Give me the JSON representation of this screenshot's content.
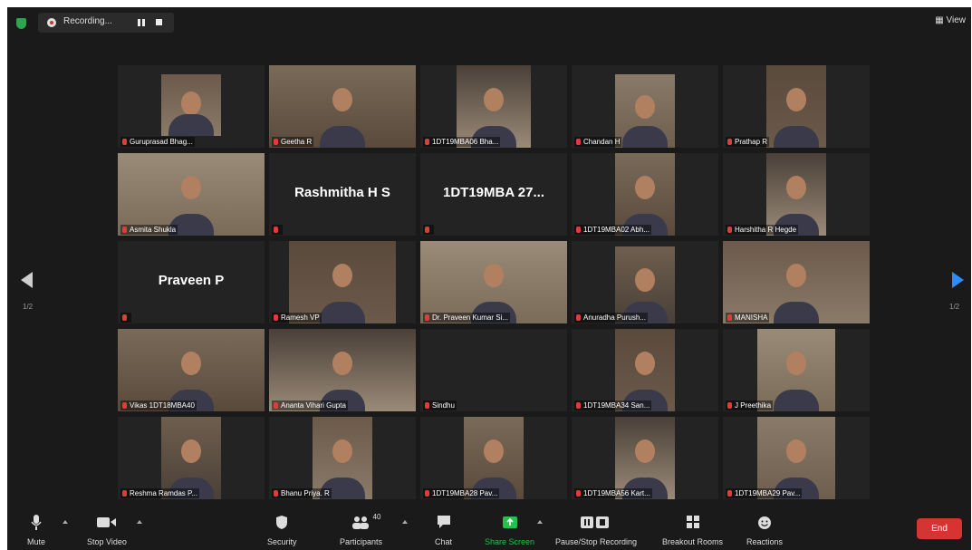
{
  "topbar": {
    "recording": "Recording...",
    "view": "View"
  },
  "nav": {
    "page_left": "1/2",
    "page_right": "1/2"
  },
  "tiles": [
    {
      "name": "Guruprasad Bhag...",
      "type": "video"
    },
    {
      "name": "Geetha R",
      "type": "video",
      "active": true
    },
    {
      "name": "1DT19MBA06 Bha...",
      "type": "video"
    },
    {
      "name": "Chandan H",
      "type": "video"
    },
    {
      "name": "Prathap R",
      "type": "video"
    },
    {
      "name": "Asmita Shukla",
      "type": "video"
    },
    {
      "name": "",
      "big": "Rashmitha H S",
      "type": "name"
    },
    {
      "name": "",
      "big": "1DT19MBA 27...",
      "type": "name"
    },
    {
      "name": "1DT19MBA02 Abh...",
      "type": "video"
    },
    {
      "name": "Harshitha R Hegde",
      "type": "video"
    },
    {
      "name": "",
      "big": "Praveen P",
      "type": "name"
    },
    {
      "name": "Ramesh VP",
      "type": "video"
    },
    {
      "name": "Dr. Praveen Kumar Si...",
      "type": "video"
    },
    {
      "name": "Anuradha Purush...",
      "type": "video"
    },
    {
      "name": "MANISHA",
      "type": "video"
    },
    {
      "name": "Vikas 1DT18MBA40",
      "type": "video"
    },
    {
      "name": "Ananta Vihari Gupta",
      "type": "video"
    },
    {
      "name": "Sindhu",
      "type": "empty"
    },
    {
      "name": "1DT19MBA34 San...",
      "type": "video"
    },
    {
      "name": "J Preethika",
      "type": "video"
    },
    {
      "name": "Reshma Ramdas P...",
      "type": "video"
    },
    {
      "name": "Bhanu Priya. R",
      "type": "video"
    },
    {
      "name": "1DT19MBA28 Pav...",
      "type": "video"
    },
    {
      "name": "1DT19MBA56 Kart...",
      "type": "video"
    },
    {
      "name": "1DT19MBA29 Pav...",
      "type": "video"
    }
  ],
  "toolbar": {
    "mute": "Mute",
    "stop_video": "Stop Video",
    "security": "Security",
    "participants": "Participants",
    "participants_count": "40",
    "chat": "Chat",
    "share_screen": "Share Screen",
    "pause_recording": "Pause/Stop Recording",
    "breakout": "Breakout Rooms",
    "reactions": "Reactions",
    "end": "End"
  },
  "colors": {
    "active_border": "#c7ee3a",
    "share_green": "#26c04b",
    "end_red": "#d83333",
    "next_arrow": "#2d8cff"
  }
}
